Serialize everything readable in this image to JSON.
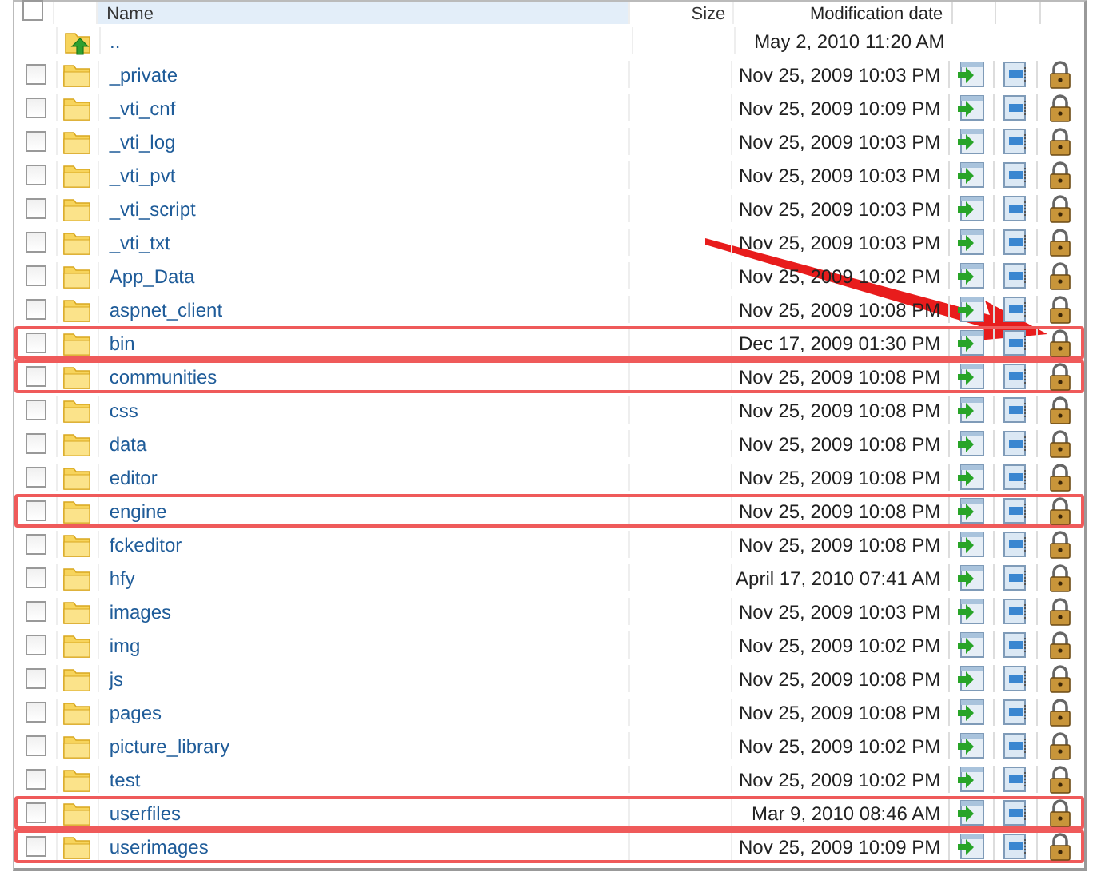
{
  "header": {
    "columns": [
      "Name",
      "Size",
      "Modification date"
    ],
    "checked": false
  },
  "rows": [
    {
      "kind": "parent",
      "name": "..",
      "date": "May 2, 2010 11:20 AM",
      "highlighted": false
    },
    {
      "kind": "folder",
      "name": "_private",
      "date": "Nov 25, 2009 10:03 PM",
      "checked": false,
      "highlighted": false
    },
    {
      "kind": "folder",
      "name": "_vti_cnf",
      "date": "Nov 25, 2009 10:09 PM",
      "checked": false,
      "highlighted": false
    },
    {
      "kind": "folder",
      "name": "_vti_log",
      "date": "Nov 25, 2009 10:03 PM",
      "checked": false,
      "highlighted": false
    },
    {
      "kind": "folder",
      "name": "_vti_pvt",
      "date": "Nov 25, 2009 10:03 PM",
      "checked": false,
      "highlighted": false
    },
    {
      "kind": "folder",
      "name": "_vti_script",
      "date": "Nov 25, 2009 10:03 PM",
      "checked": false,
      "highlighted": false
    },
    {
      "kind": "folder",
      "name": "_vti_txt",
      "date": "Nov 25, 2009 10:03 PM",
      "checked": false,
      "highlighted": false
    },
    {
      "kind": "folder",
      "name": "App_Data",
      "date": "Nov 25, 2009 10:02 PM",
      "checked": false,
      "highlighted": false
    },
    {
      "kind": "folder",
      "name": "aspnet_client",
      "date": "Nov 25, 2009 10:08 PM",
      "checked": false,
      "highlighted": false
    },
    {
      "kind": "folder",
      "name": "bin",
      "date": "Dec 17, 2009 01:30 PM",
      "checked": false,
      "highlighted": true
    },
    {
      "kind": "folder",
      "name": "communities",
      "date": "Nov 25, 2009 10:08 PM",
      "checked": false,
      "highlighted": true
    },
    {
      "kind": "folder",
      "name": "css",
      "date": "Nov 25, 2009 10:08 PM",
      "checked": false,
      "highlighted": false
    },
    {
      "kind": "folder",
      "name": "data",
      "date": "Nov 25, 2009 10:08 PM",
      "checked": false,
      "highlighted": false
    },
    {
      "kind": "folder",
      "name": "editor",
      "date": "Nov 25, 2009 10:08 PM",
      "checked": false,
      "highlighted": false
    },
    {
      "kind": "folder",
      "name": "engine",
      "date": "Nov 25, 2009 10:08 PM",
      "checked": false,
      "highlighted": true
    },
    {
      "kind": "folder",
      "name": "fckeditor",
      "date": "Nov 25, 2009 10:08 PM",
      "checked": false,
      "highlighted": false
    },
    {
      "kind": "folder",
      "name": "hfy",
      "date": "April 17, 2010 07:41 AM",
      "checked": false,
      "highlighted": false
    },
    {
      "kind": "folder",
      "name": "images",
      "date": "Nov 25, 2009 10:03 PM",
      "checked": false,
      "highlighted": false
    },
    {
      "kind": "folder",
      "name": "img",
      "date": "Nov 25, 2009 10:02 PM",
      "checked": false,
      "highlighted": false
    },
    {
      "kind": "folder",
      "name": "js",
      "date": "Nov 25, 2009 10:08 PM",
      "checked": false,
      "highlighted": false
    },
    {
      "kind": "folder",
      "name": "pages",
      "date": "Nov 25, 2009 10:08 PM",
      "checked": false,
      "highlighted": false
    },
    {
      "kind": "folder",
      "name": "picture_library",
      "date": "Nov 25, 2009 10:02 PM",
      "checked": false,
      "highlighted": false
    },
    {
      "kind": "folder",
      "name": "test",
      "date": "Nov 25, 2009 10:02 PM",
      "checked": false,
      "highlighted": false
    },
    {
      "kind": "folder",
      "name": "userfiles",
      "date": "Mar 9, 2010 08:46 AM",
      "checked": false,
      "highlighted": true
    },
    {
      "kind": "folder",
      "name": "userimages",
      "date": "Nov 25, 2009 10:09 PM",
      "checked": false,
      "highlighted": true
    }
  ]
}
